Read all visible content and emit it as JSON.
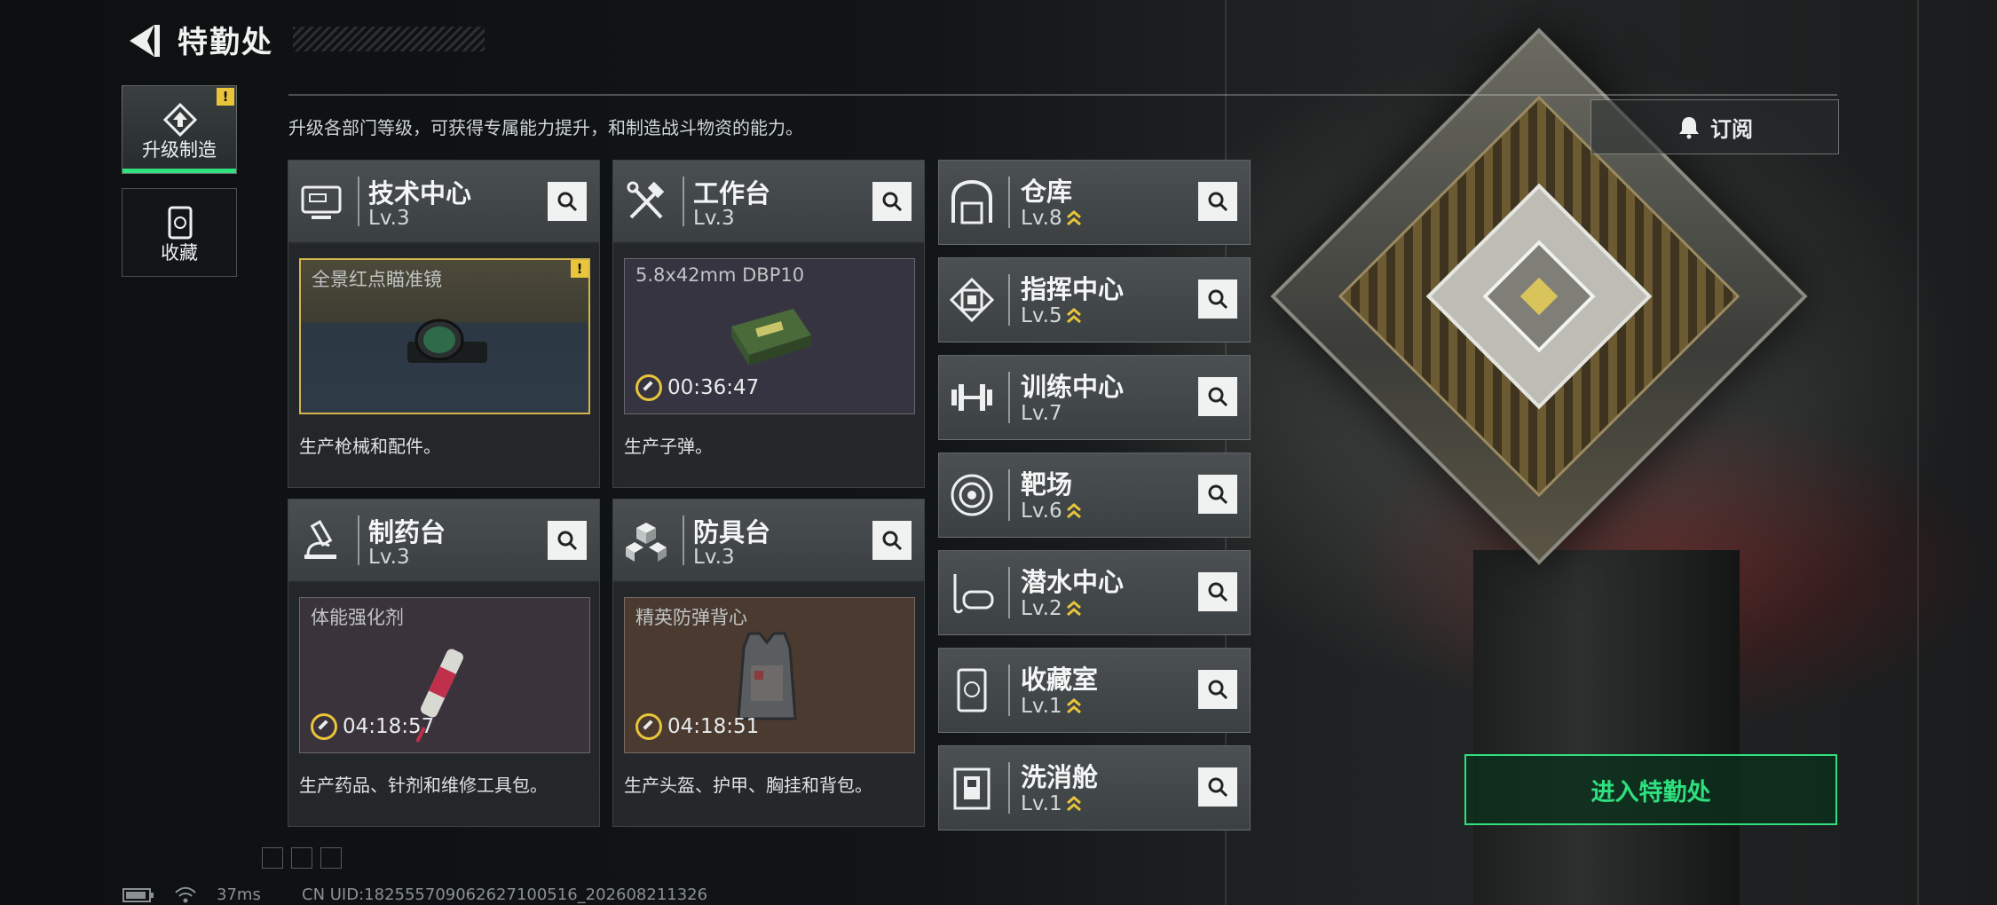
{
  "header": {
    "title": "特勤处",
    "description": "升级各部门等级，可获得专属能力提升，和制造战斗物资的能力。",
    "subscribe_label": "订阅"
  },
  "side_tabs": [
    {
      "label": "升级制造",
      "active": true,
      "alert": "!"
    },
    {
      "label": "收藏",
      "active": false
    }
  ],
  "cards": [
    {
      "name": "技术中心",
      "level": "Lv.3",
      "product": "全景红点瞄准镜",
      "timer": "",
      "alert": "!",
      "desc": "生产枪械和配件。"
    },
    {
      "name": "工作台",
      "level": "Lv.3",
      "product": "5.8x42mm DBP10",
      "timer": "00:36:47",
      "desc": "生产子弹。"
    },
    {
      "name": "制药台",
      "level": "Lv.3",
      "product": "体能强化剂",
      "timer": "04:18:57",
      "desc": "生产药品、针剂和维修工具包。"
    },
    {
      "name": "防具台",
      "level": "Lv.3",
      "product": "精英防弹背心",
      "timer": "04:18:51",
      "desc": "生产头盔、护甲、胸挂和背包。"
    }
  ],
  "departments": [
    {
      "name": "仓库",
      "level": "Lv.8",
      "icon": "warehouse-icon"
    },
    {
      "name": "指挥中心",
      "level": "Lv.5",
      "icon": "command-chip-icon"
    },
    {
      "name": "训练中心",
      "level": "Lv.7",
      "icon": "dumbbell-icon"
    },
    {
      "name": "靶场",
      "level": "Lv.6",
      "icon": "target-icon"
    },
    {
      "name": "潜水中心",
      "level": "Lv.2",
      "icon": "diving-mask-icon"
    },
    {
      "name": "收藏室",
      "level": "Lv.1",
      "icon": "collection-case-icon"
    },
    {
      "name": "洗消舱",
      "level": "Lv.1",
      "icon": "decon-chamber-icon"
    }
  ],
  "enter_button": "进入特勤处",
  "status": {
    "ping": "37ms",
    "uid": "CN UID:18255570906262710051​6_202608211326"
  },
  "colors": {
    "accent_green": "#2ee07e",
    "upgrade_yellow": "#e8c53a"
  }
}
